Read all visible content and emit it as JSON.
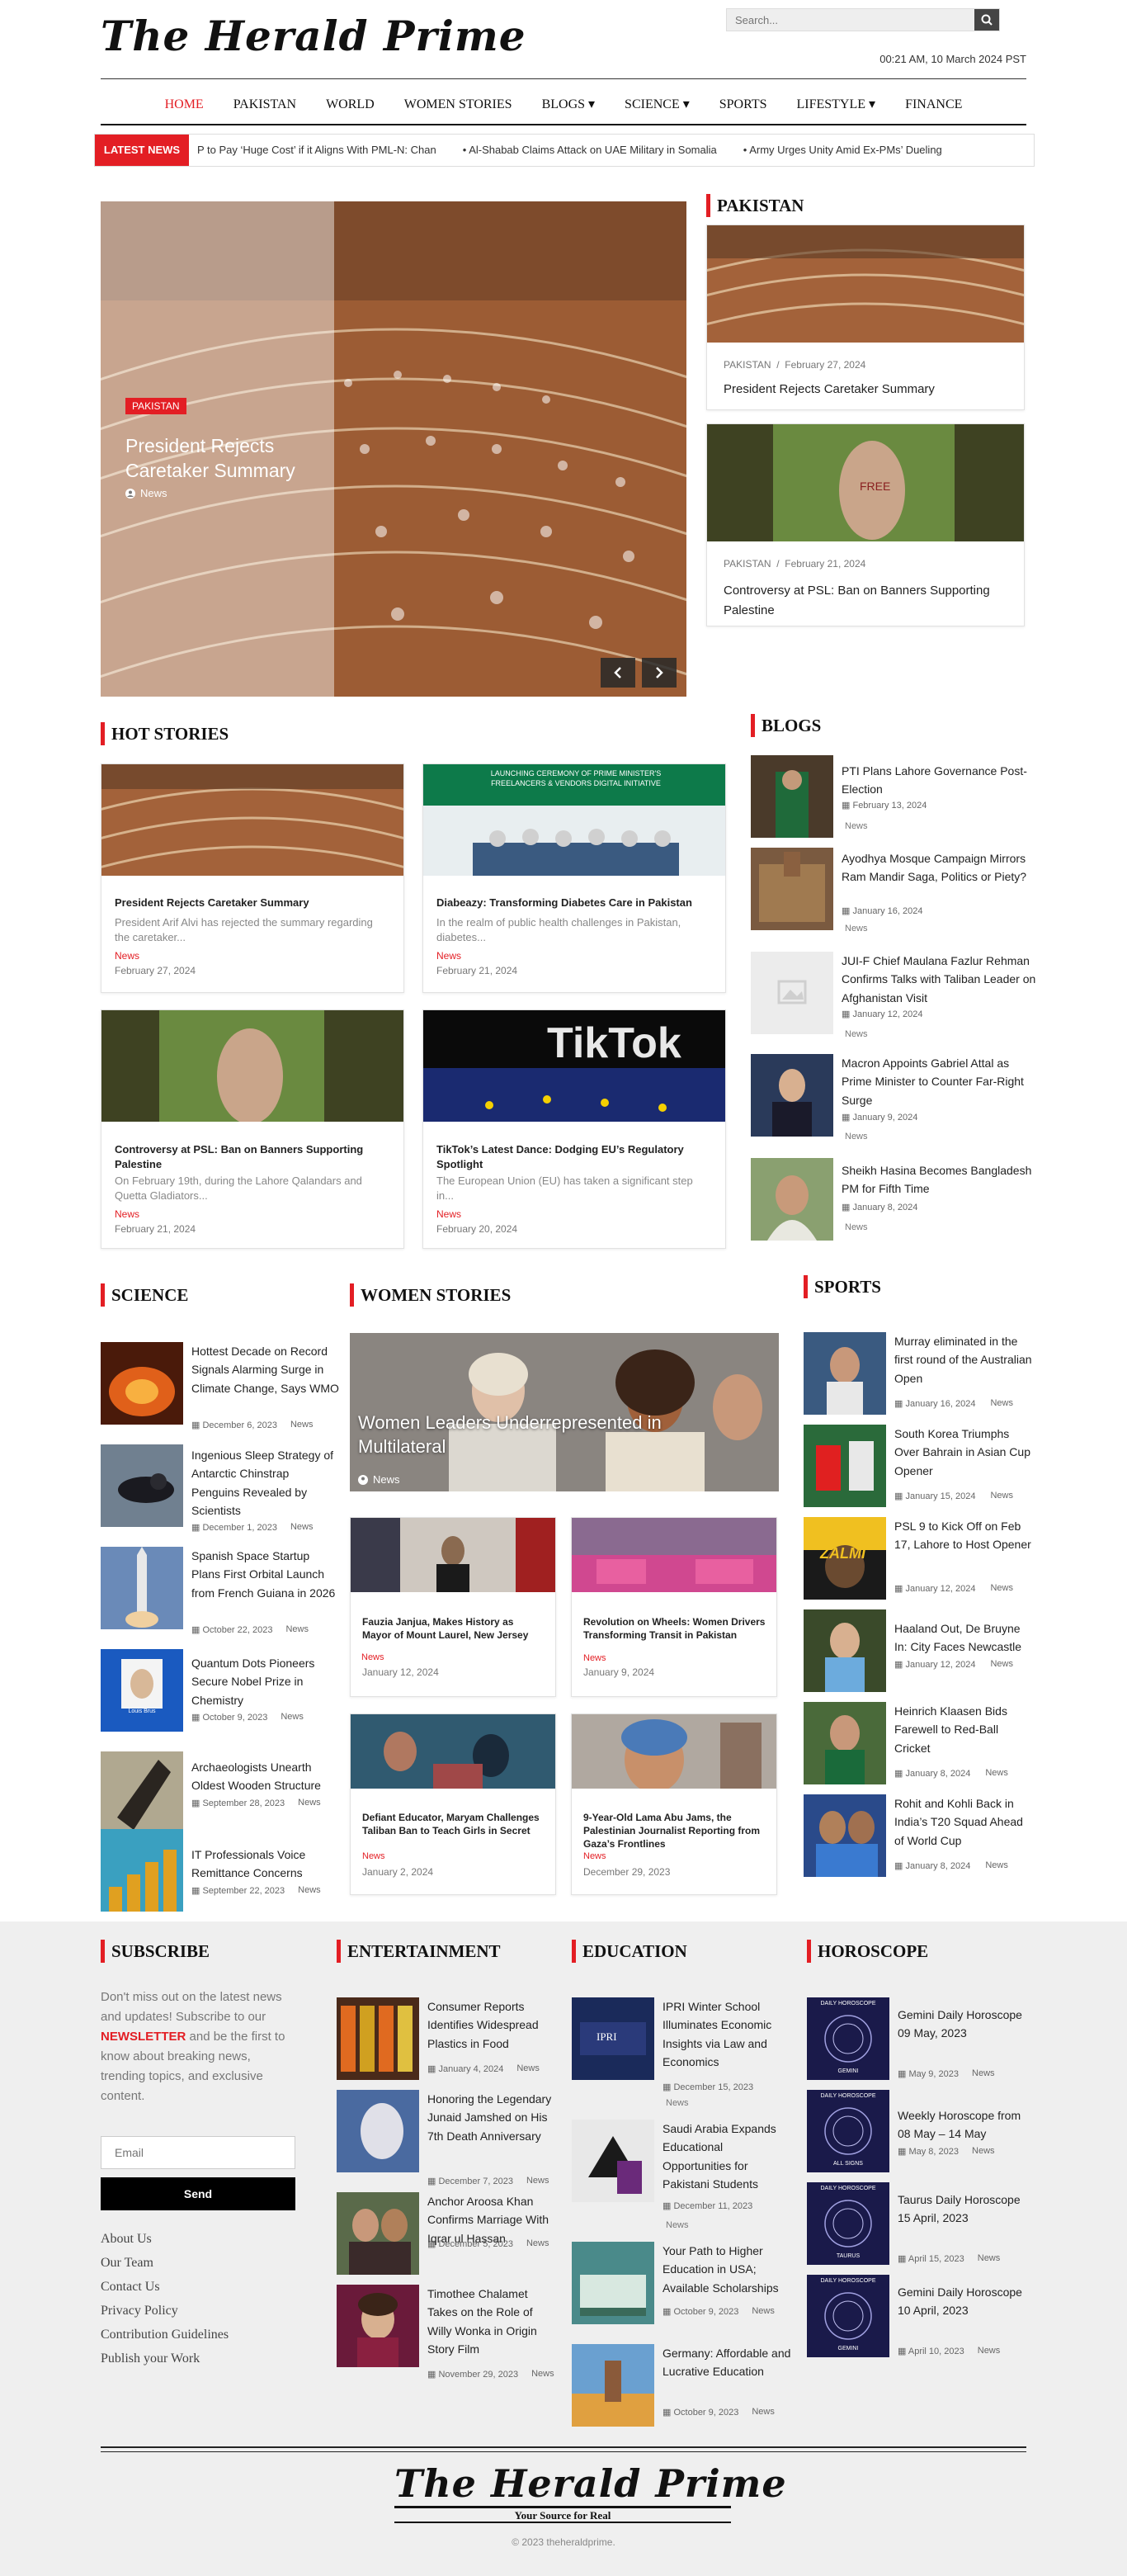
{
  "header": {
    "logo": "The Herald Prime",
    "search_placeholder": "Search...",
    "datetime": "00:21 AM, 10 March 2024 PST"
  },
  "nav": {
    "items": [
      "HOME",
      "PAKISTAN",
      "WORLD",
      "WOMEN STORIES",
      "BLOGS ▾",
      "SCIENCE ▾",
      "SPORTS",
      "LIFESTYLE ▾",
      "FINANCE"
    ]
  },
  "ticker": {
    "label": "LATEST NEWS",
    "items": [
      "P to Pay ‘Huge Cost’ if it Aligns With PML-N: Chan",
      "Al-Shabab Claims Attack on UAE Military in Somalia",
      "Army Urges Unity Amid Ex-PMs’ Dueling"
    ]
  },
  "hero": {
    "tag": "PAKISTAN",
    "title": "President Rejects Caretaker Summary",
    "author": "News",
    "prev_icon": "chevron-left-icon",
    "next_icon": "chevron-right-icon"
  },
  "pakistan": {
    "heading": "PAKISTAN",
    "cards": [
      {
        "category": "PAKISTAN",
        "sep": "/",
        "date": "February 27, 2024",
        "title": "President Rejects Caretaker Summary"
      },
      {
        "category": "PAKISTAN",
        "sep": "/",
        "date": "February 21, 2024",
        "title": "Controversy at PSL: Ban on Banners Supporting Palestine"
      }
    ]
  },
  "hot_stories": {
    "heading": "HOT STORIES",
    "items": [
      {
        "title": "President Rejects Caretaker Summary",
        "excerpt": "President Arif Alvi has rejected the summary regarding the caretaker...",
        "tag": "News",
        "date": "February 27, 2024"
      },
      {
        "title": "Diabeazy: Transforming Diabetes Care in Pakistan",
        "excerpt": "In the realm of public health challenges in Pakistan, diabetes...",
        "tag": "News",
        "date": "February 21, 2024"
      },
      {
        "title": "Controversy at PSL: Ban on Banners Supporting Palestine",
        "excerpt": "On February 19th, during the Lahore Qalandars and Quetta Gladiators...",
        "tag": "News",
        "date": "February 21, 2024"
      },
      {
        "title": "TikTok’s Latest Dance: Dodging EU’s Regulatory Spotlight",
        "excerpt": "The European Union (EU) has taken a significant step in...",
        "tag": "News",
        "date": "February 20, 2024"
      }
    ],
    "banner_text": "LAUNCHING CEREMONY OF PRIME MINISTER'S FREELANCERS & VENDORS DIGITAL INITIATIVE",
    "tiktok_text": "TikTok"
  },
  "blogs": {
    "heading": "BLOGS",
    "items": [
      {
        "title": "PTI Plans Lahore Governance Post-Election",
        "date": "February 13, 2024",
        "tag": "News"
      },
      {
        "title": "Ayodhya Mosque Campaign Mirrors Ram Mandir Saga, Politics or Piety?",
        "date": "January 16, 2024",
        "tag": "News"
      },
      {
        "title": "JUI-F Chief Maulana Fazlur Rehman Confirms Talks with Taliban Leader on Afghanistan Visit",
        "date": "January 12, 2024",
        "tag": "News"
      },
      {
        "title": "Macron Appoints Gabriel Attal as Prime Minister to Counter Far-Right Surge",
        "date": "January 9, 2024",
        "tag": "News"
      },
      {
        "title": "Sheikh Hasina Becomes Bangladesh PM for Fifth Time",
        "date": "January 8, 2024",
        "tag": "News"
      }
    ]
  },
  "science": {
    "heading": "SCIENCE",
    "items": [
      {
        "title": "Hottest Decade on Record Signals Alarming Surge in Climate Change, Says WMO",
        "date": "December 6, 2023",
        "tag": "News"
      },
      {
        "title": "Ingenious Sleep Strategy of Antarctic Chinstrap Penguins Revealed by Scientists",
        "date": "December 1, 2023",
        "tag": "News"
      },
      {
        "title": "Spanish Space Startup Plans First Orbital Launch from French Guiana in 2026",
        "date": "October 22, 2023",
        "tag": "News"
      },
      {
        "title": "Quantum Dots Pioneers Secure Nobel Prize in Chemistry",
        "date": "October 9, 2023",
        "tag": "News"
      },
      {
        "title": "Archaeologists Unearth Oldest Wooden Structure",
        "date": "September 28, 2023",
        "tag": "News"
      },
      {
        "title": "IT Professionals Voice Remittance Concerns",
        "date": "September 22, 2023",
        "tag": "News"
      }
    ],
    "nobel_caption": "Louis Brus"
  },
  "women": {
    "heading": "WOMEN STORIES",
    "feature_title": "Women Leaders Underrepresented in Multilateral",
    "feature_author": "News",
    "items": [
      {
        "title": "Fauzia Janjua, Makes History as Mayor of Mount Laurel, New Jersey",
        "tag": "News",
        "date": "January 12, 2024"
      },
      {
        "title": "Revolution on Wheels: Women Drivers Transforming Transit in Pakistan",
        "tag": "News",
        "date": "January 9, 2024"
      },
      {
        "title": "Defiant Educator, Maryam Challenges Taliban Ban to Teach Girls in Secret",
        "tag": "News",
        "date": "January 2, 2024"
      },
      {
        "title": "9-Year-Old Lama Abu Jams, the Palestinian Journalist Reporting from Gaza’s Frontlines",
        "tag": "News",
        "date": "December 29, 2023"
      }
    ]
  },
  "sports": {
    "heading": "SPORTS",
    "items": [
      {
        "title": "Murray eliminated in the first round of the Australian Open",
        "date": "January 16, 2024",
        "tag": "News"
      },
      {
        "title": "South Korea Triumphs Over Bahrain in Asian Cup Opener",
        "date": "January 15, 2024",
        "tag": "News"
      },
      {
        "title": "PSL 9 to Kick Off on Feb 17, Lahore to Host Opener",
        "date": "January 12, 2024",
        "tag": "News"
      },
      {
        "title": "Haaland Out, De Bruyne In: City Faces Newcastle",
        "date": "January 12, 2024",
        "tag": "News"
      },
      {
        "title": "Heinrich Klaasen Bids Farewell to Red-Ball Cricket",
        "date": "January 8, 2024",
        "tag": "News"
      },
      {
        "title": "Rohit and Kohli Back in India’s T20 Squad Ahead of World Cup",
        "date": "January 8, 2024",
        "tag": "News"
      }
    ],
    "zalmi_text": "ZALMI"
  },
  "subscribe": {
    "heading": "SUBSCRIBE",
    "text_before": "Don't miss out on the latest news and updates! Subscribe to our",
    "highlight": "NEWSLETTER",
    "text_after": "and be the first to know about breaking news, trending topics, and exclusive content.",
    "email_placeholder": "Email",
    "send_label": "Send",
    "links": [
      "About Us",
      "Our Team",
      "Contact Us",
      "Privacy Policy",
      "Contribution Guidelines",
      "Publish your Work"
    ]
  },
  "entertainment": {
    "heading": "ENTERTAINMENT",
    "items": [
      {
        "title": "Consumer Reports Identifies Widespread Plastics in Food",
        "date": "January 4, 2024",
        "tag": "News"
      },
      {
        "title": "Honoring the Legendary Junaid Jamshed on His 7th Death Anniversary",
        "date": "December 7, 2023",
        "tag": "News"
      },
      {
        "title": "Anchor Aroosa Khan Confirms Marriage With Iqrar ul Hassan",
        "date": "December 5, 2023",
        "tag": "News"
      },
      {
        "title": "Timothee Chalamet Takes on the Role of Willy Wonka in Origin Story Film",
        "date": "November 29, 2023",
        "tag": "News"
      }
    ]
  },
  "education": {
    "heading": "EDUCATION",
    "items": [
      {
        "title": "IPRI Winter School Illuminates Economic Insights via Law and Economics",
        "date": "December 15, 2023",
        "tag": "News"
      },
      {
        "title": "Saudi Arabia Expands Educational Opportunities for Pakistani Students",
        "date": "December 11, 2023",
        "tag": "News"
      },
      {
        "title": "Your Path to Higher Education in USA; Available Scholarships",
        "date": "October 9, 2023",
        "tag": "News"
      },
      {
        "title": "Germany: Affordable and Lucrative Education",
        "date": "October 9, 2023",
        "tag": "News"
      }
    ],
    "ipri_text": "IPRI"
  },
  "horoscope": {
    "heading": "HOROSCOPE",
    "items": [
      {
        "title": "Gemini Daily Horoscope 09 May, 2023",
        "date": "May 9, 2023",
        "tag": "News",
        "img_label": "GEMINI"
      },
      {
        "title": "Weekly Horoscope from 08 May – 14 May",
        "date": "May 8, 2023",
        "tag": "News",
        "img_label": "ALL SIGNS"
      },
      {
        "title": "Taurus Daily Horoscope 15 April, 2023",
        "date": "April 15, 2023",
        "tag": "News",
        "img_label": "TAURUS"
      },
      {
        "title": "Gemini Daily Horoscope 10 April, 2023",
        "date": "April 10, 2023",
        "tag": "News",
        "img_label": "GEMINI"
      }
    ],
    "img_heading": "DAILY HOROSCOPE"
  },
  "footer": {
    "logo": "The Herald Prime",
    "tagline": "Your Source for Real",
    "copyright": "© 2023 theheraldprime."
  },
  "colors": {
    "accent": "#e31e24",
    "footer_bg": "#efefef"
  }
}
